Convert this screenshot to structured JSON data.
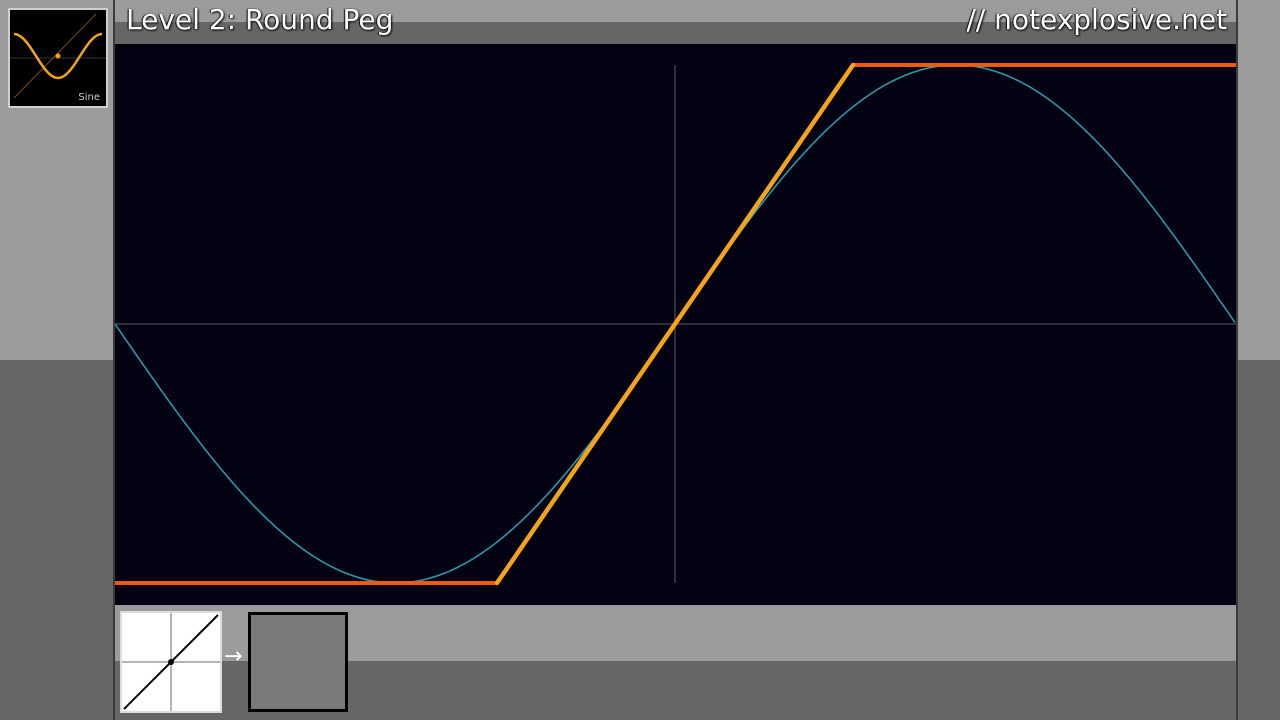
{
  "header": {
    "title": "Level 2: Round Peg",
    "site": "// notexplosive.net"
  },
  "level_thumbnail": {
    "label": "Sine"
  },
  "scope": {
    "input_waveform": "sine",
    "output_waveform": "clipped sine",
    "colors": {
      "background": "#020212",
      "input_trace": "#2a98a8",
      "output_trace": "#f3a41c",
      "clipped_trace": "#ef5a16",
      "axes": "#5a5a66"
    }
  },
  "toolbar": {
    "transfer_icon": "transfer-function-icon",
    "arrow": "→",
    "output_icon": "output-slot-icon"
  }
}
